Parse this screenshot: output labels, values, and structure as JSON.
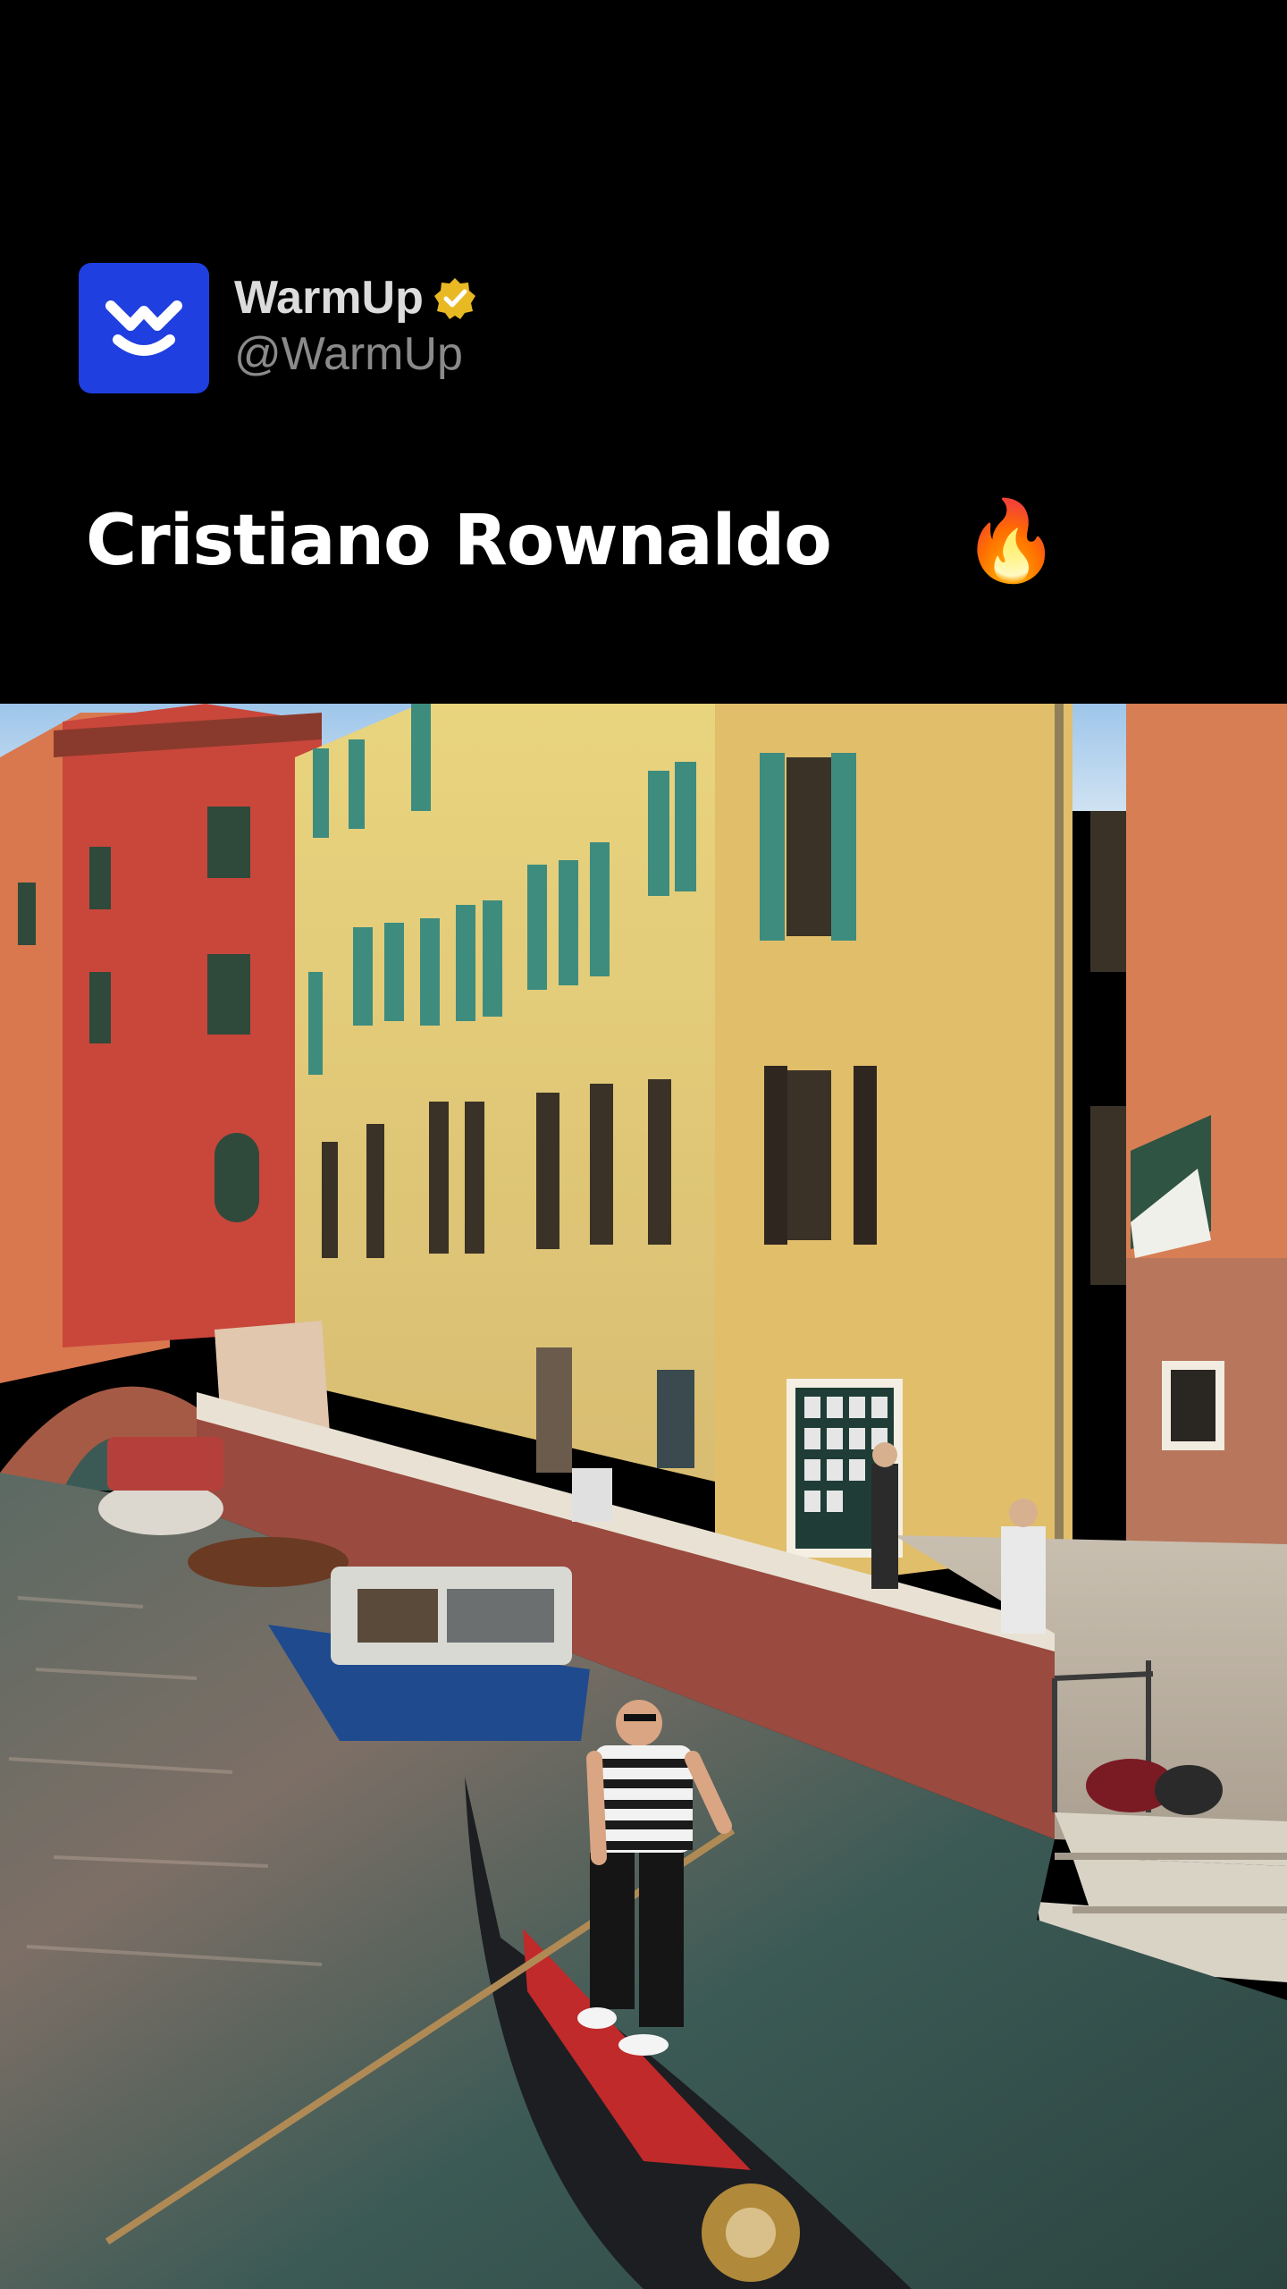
{
  "post": {
    "display_name": "WarmUp",
    "handle": "@WarmUp",
    "caption": "Cristiano Rownaldo",
    "caption_emojis": [
      "😭",
      "🔥"
    ],
    "avatar_icon": "warmup-logo-icon",
    "verified_icon": "verified-badge-icon"
  },
  "colors": {
    "background": "#000000",
    "avatar_blue": "#1f3fe0",
    "verified_gold": "#e8b923"
  },
  "media": {
    "type": "video",
    "scene": "venice-canal-gondola"
  }
}
